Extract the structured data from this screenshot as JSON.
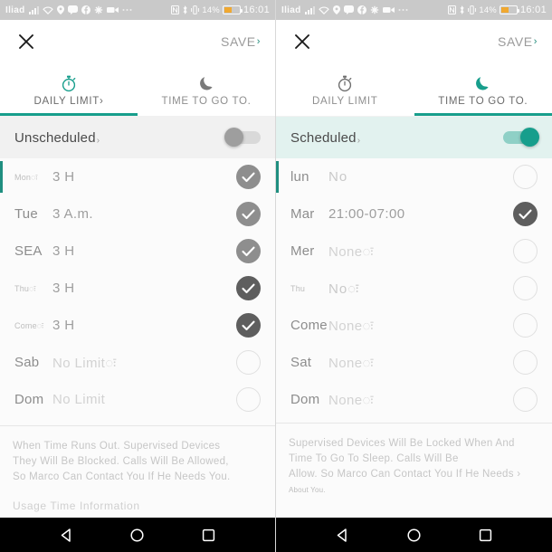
{
  "status_bar": {
    "carrier": "Iliad",
    "battery_percent": "14%",
    "clock": "16:01",
    "icons": [
      "signal-bars-icon",
      "wifi-icon",
      "location-pin-icon",
      "message-icon",
      "facebook-icon",
      "asterisk-icon",
      "video-camera-icon",
      "ellipsis-icon"
    ],
    "right_icons": [
      "nfc-icon",
      "bluetooth-icon",
      "vibrate-icon",
      "battery-icon"
    ]
  },
  "colors": {
    "accent": "#179e8c",
    "accent_dark": "#1f8f80",
    "toggle_on_bg": "#e2f2ef",
    "checked_gray": "#8e8e8e",
    "checked_dark": "#5e5e5e"
  },
  "left_screen": {
    "appbar": {
      "close_label": "close-icon",
      "save_label": "SAVE",
      "save_caret": "›"
    },
    "tabs": [
      {
        "label": "DAILY LIMIT›",
        "icon": "stopwatch-icon",
        "active": true
      },
      {
        "label": "TIME TO GO TO.",
        "icon": "moon-icon",
        "active": false
      }
    ],
    "master_toggle": {
      "label": "Unscheduled",
      "caret": "›",
      "on": false
    },
    "rows": [
      {
        "day": "Monः",
        "value": "3 H",
        "checked": true,
        "day_style": "tiny",
        "value_style": ""
      },
      {
        "day": "Tue",
        "value": "3 A.m.",
        "checked": true,
        "day_style": "norm",
        "value_style": ""
      },
      {
        "day": "SEA",
        "value": "3 H",
        "checked": true,
        "day_style": "norm",
        "value_style": ""
      },
      {
        "day": "Thuः",
        "value": "3 H",
        "checked": true,
        "day_style": "tiny",
        "value_style": ""
      },
      {
        "day": "Comeः",
        "value": "3 H",
        "checked": true,
        "day_style": "tiny",
        "value_style": ""
      },
      {
        "day": "Sab",
        "value": "No Limitः",
        "checked": false,
        "day_style": "norm",
        "value_style": "faded"
      },
      {
        "day": "Dom",
        "value": "No Limit",
        "checked": false,
        "day_style": "norm",
        "value_style": "faded"
      }
    ],
    "footer": {
      "lines": [
        "When Time Runs Out. Supervised Devices",
        "They Will Be Blocked. Calls Will Be Allowed,",
        "So Marco Can Contact You If He Needs You."
      ],
      "usage": "Usage Time Information"
    }
  },
  "right_screen": {
    "appbar": {
      "close_label": "close-icon",
      "save_label": "SAVE",
      "save_caret": "›"
    },
    "tabs": [
      {
        "label": "DAILY LIMIT",
        "icon": "stopwatch-icon",
        "active": false
      },
      {
        "label": "TIME TO GO TO.",
        "icon": "moon-icon",
        "active": true
      }
    ],
    "master_toggle": {
      "label": "Scheduled",
      "caret": "›",
      "on": true
    },
    "rows": [
      {
        "day": "lun",
        "value": "No",
        "checked": false,
        "day_style": "norm",
        "value_style": "blur"
      },
      {
        "day": "Mar",
        "value": "21:00-07:00",
        "checked": true,
        "day_style": "norm",
        "value_style": ""
      },
      {
        "day": "Mer",
        "value": "Noneः",
        "checked": false,
        "day_style": "norm",
        "value_style": "faded"
      },
      {
        "day": "Thu",
        "value": "Noः",
        "checked": false,
        "day_style": "tiny",
        "value_style": "blur"
      },
      {
        "day": "Come",
        "value": "Noneः",
        "checked": false,
        "day_style": "norm",
        "value_style": "faded"
      },
      {
        "day": "Sat",
        "value": "Noneः",
        "checked": false,
        "day_style": "norm",
        "value_style": "faded"
      },
      {
        "day": "Dom",
        "value": "Noneः",
        "checked": false,
        "day_style": "norm",
        "value_style": "faded"
      }
    ],
    "footer": {
      "lines": [
        "Supervised Devices Will Be Locked When And",
        "Time To Go To Sleep. Calls Will Be",
        "Allow. So Marco Can Contact You If He Needs ›"
      ],
      "small_line": "About You.",
      "usage": ""
    }
  },
  "navbar": {
    "items": [
      {
        "name": "back-triangle-icon",
        "label": "Back"
      },
      {
        "name": "home-circle-icon",
        "label": "Home"
      },
      {
        "name": "recents-square-icon",
        "label": "Recents"
      }
    ]
  }
}
